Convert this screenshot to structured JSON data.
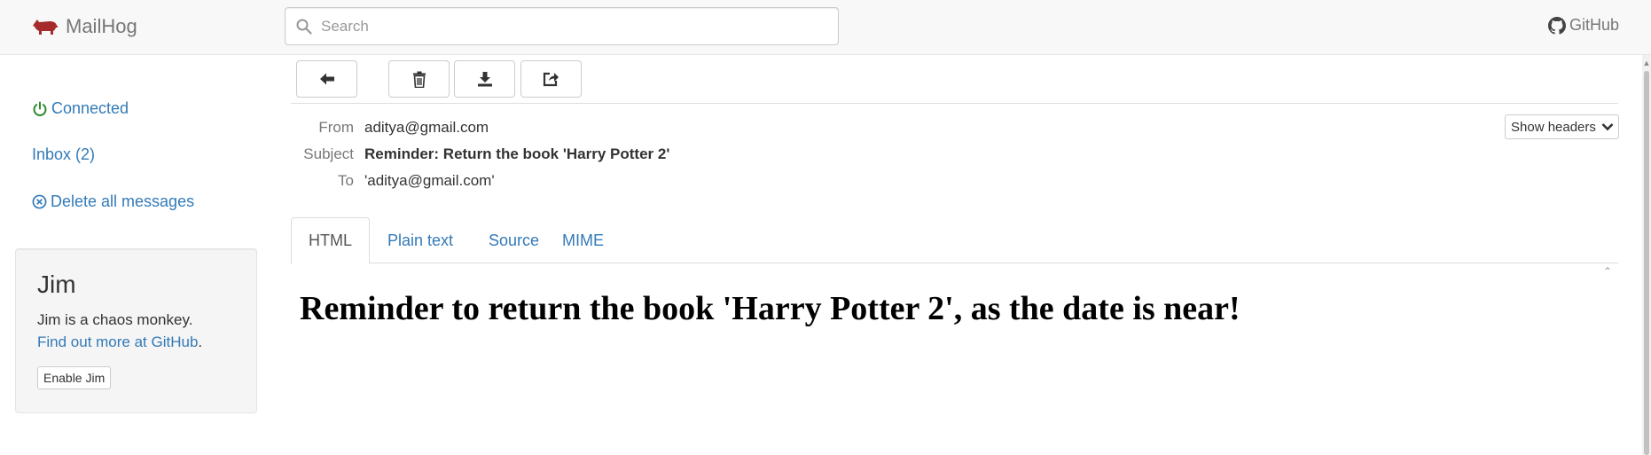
{
  "app": {
    "brand": "MailHog",
    "github_label": "GitHub",
    "search": {
      "placeholder": "Search",
      "value": ""
    }
  },
  "sidebar": {
    "status": {
      "label": "Connected",
      "color": "#2e8b2e"
    },
    "inbox": {
      "label": "Inbox (2)"
    },
    "delete_all": {
      "label": "Delete all messages"
    },
    "jim": {
      "title": "Jim",
      "description": "Jim is a chaos monkey.",
      "link_text": "Find out more at GitHub",
      "link_suffix": ".",
      "button_label": "Enable Jim"
    }
  },
  "toolbar": {
    "buttons": [
      {
        "icon": "arrow-left-icon"
      },
      {
        "icon": "trash-icon"
      },
      {
        "icon": "download-icon"
      },
      {
        "icon": "share-icon"
      }
    ]
  },
  "message": {
    "headers": {
      "from_label": "From",
      "from": "aditya@gmail.com",
      "subject_label": "Subject",
      "subject": "Reminder: Return the book 'Harry Potter 2'",
      "to_label": "To",
      "to": "'aditya@gmail.com'"
    },
    "show_headers_label": "Show headers",
    "tabs": [
      {
        "label": "HTML",
        "active": true
      },
      {
        "label": "Plain text",
        "active": false
      },
      {
        "label": "Source",
        "active": false
      },
      {
        "label": "MIME",
        "active": false
      }
    ],
    "body_html_text": "Reminder to return the book 'Harry Potter 2', as the date is near!"
  },
  "colors": {
    "link": "#337ab7",
    "brand_icon": "#a52a2a",
    "connected": "#2e8b2e"
  }
}
